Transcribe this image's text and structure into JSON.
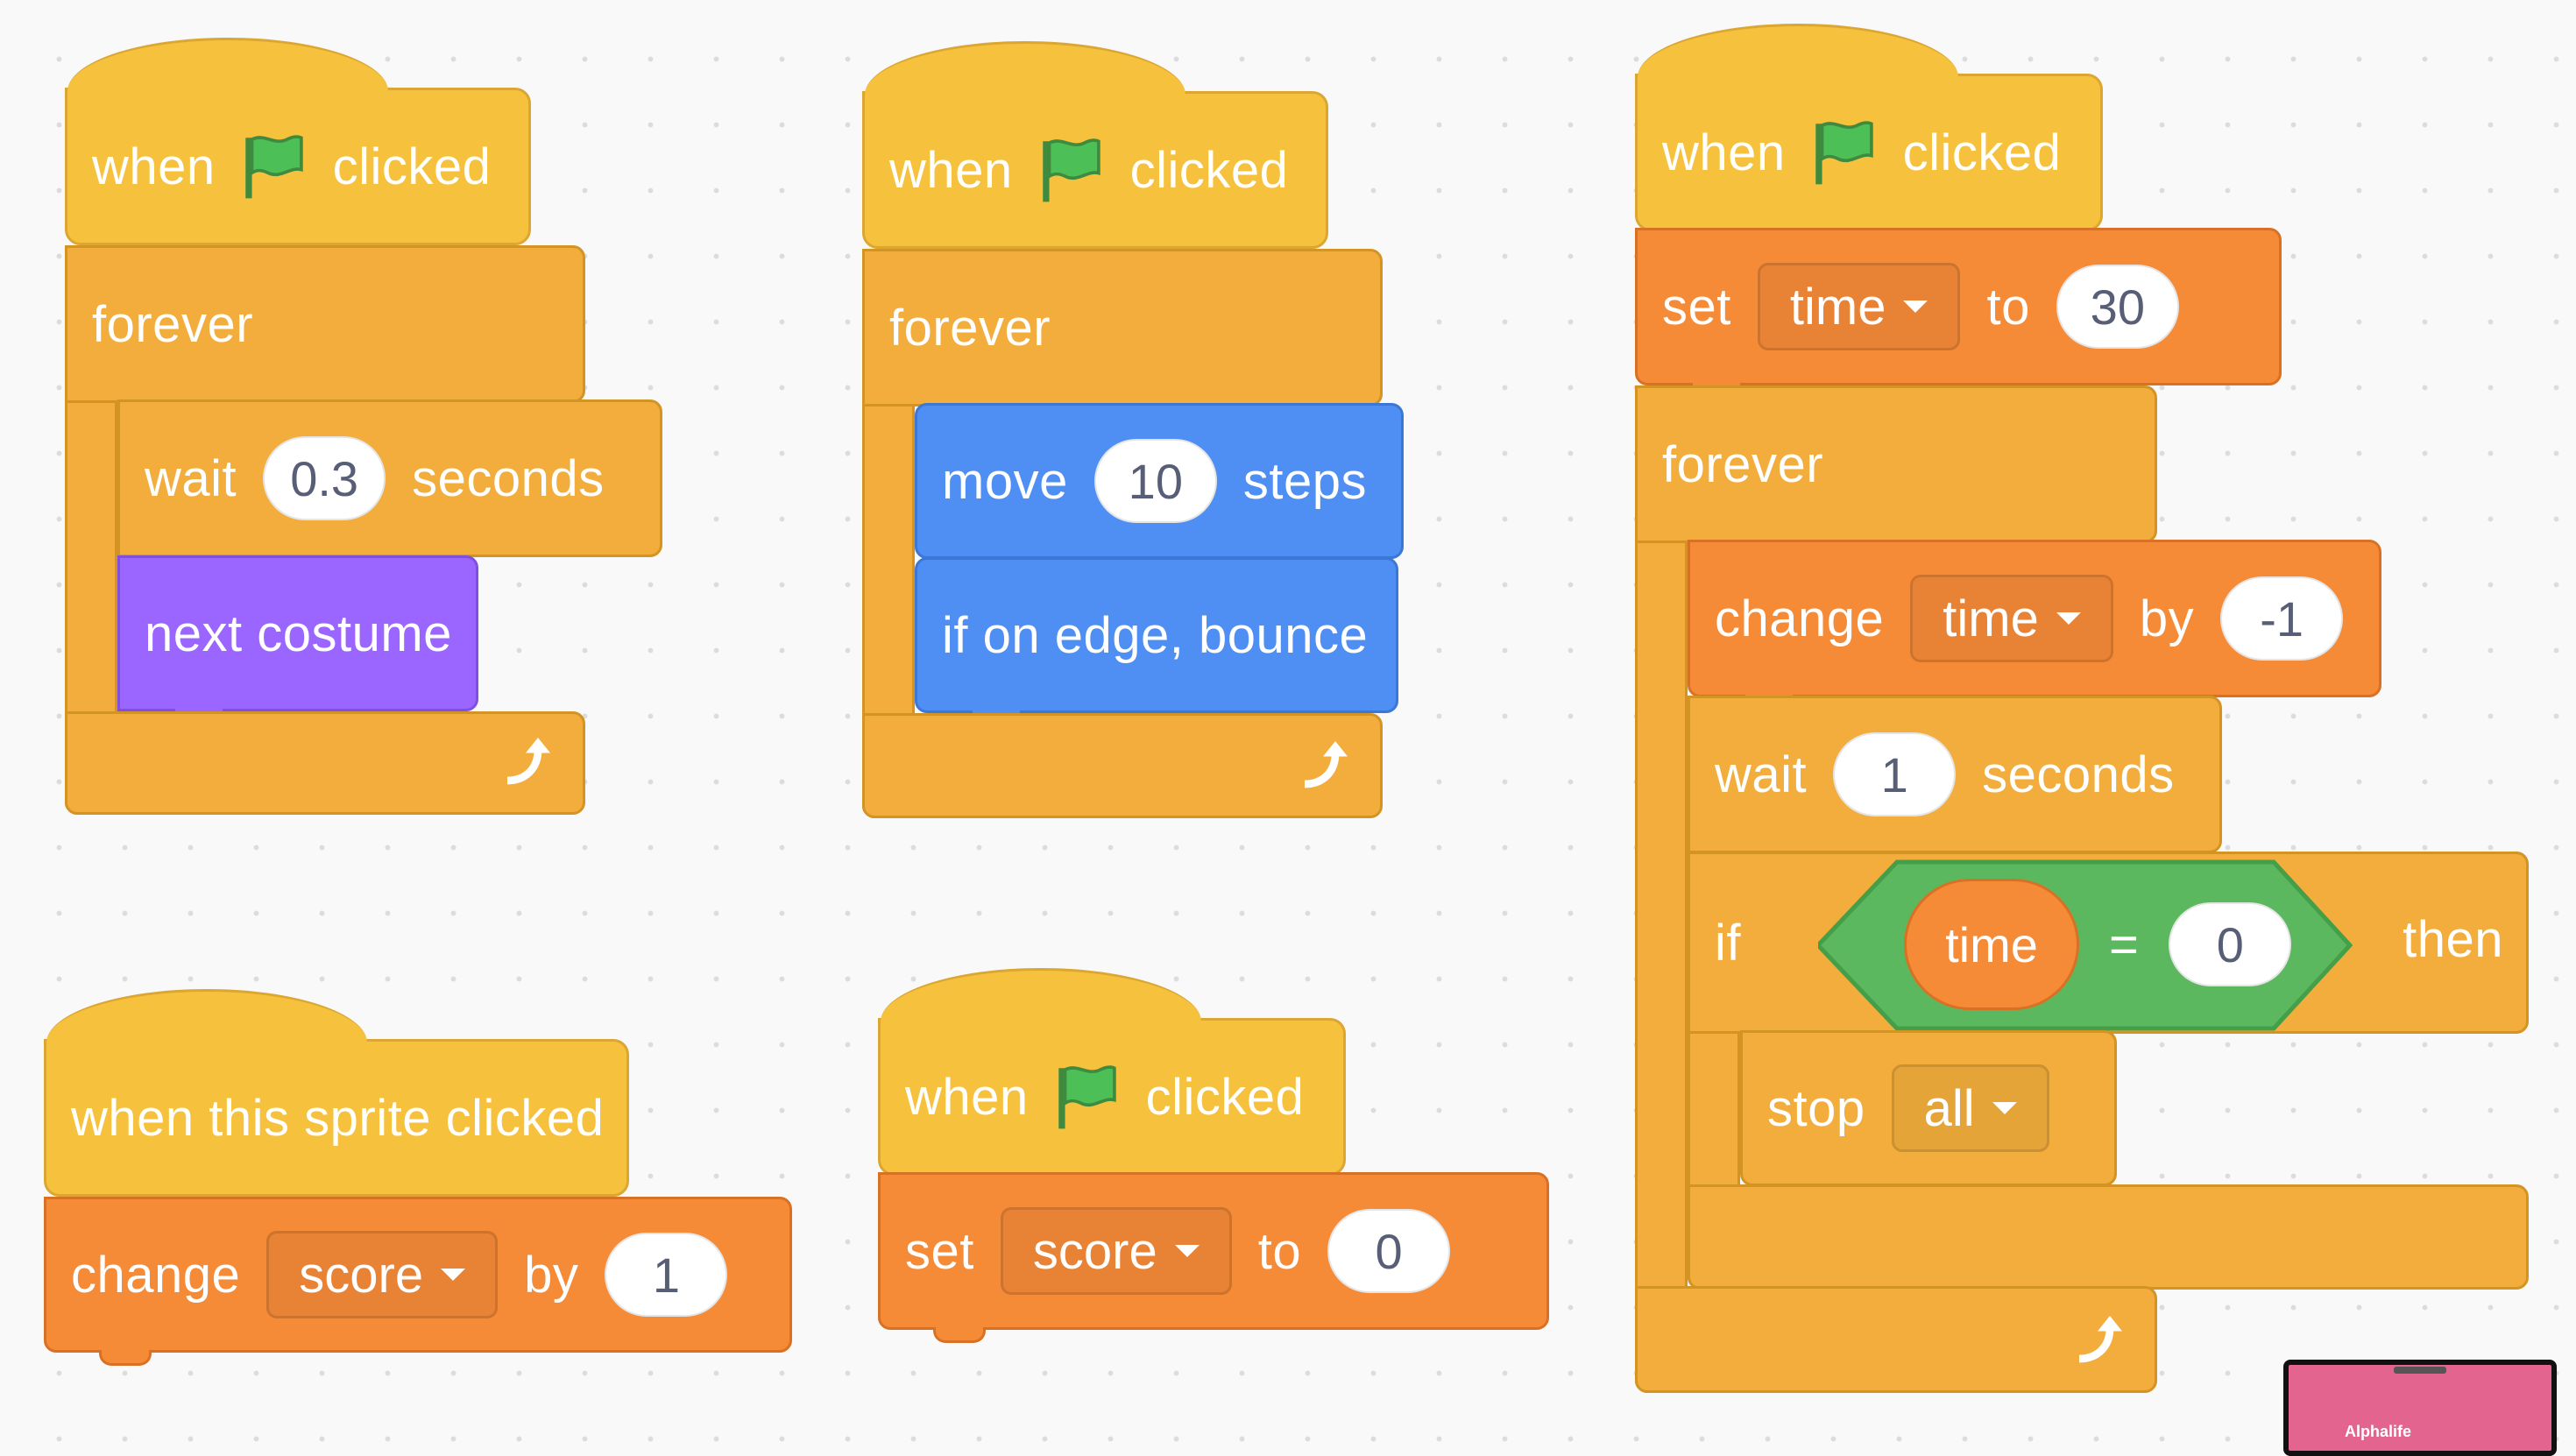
{
  "scripts": [
    {
      "hat": {
        "w1": "when",
        "icon": "green-flag-icon",
        "w2": "clicked"
      },
      "forever": "forever",
      "body": [
        {
          "type": "wait",
          "w1": "wait",
          "value": "0.3",
          "w2": "seconds"
        },
        {
          "type": "looks",
          "label": "next costume"
        }
      ]
    },
    {
      "hat": {
        "w1": "when",
        "icon": "green-flag-icon",
        "w2": "clicked"
      },
      "forever": "forever",
      "body": [
        {
          "type": "motion",
          "w1": "move",
          "value": "10",
          "w2": "steps"
        },
        {
          "type": "motion",
          "label": "if on edge, bounce"
        }
      ]
    },
    {
      "hat": {
        "w1": "when",
        "icon": "green-flag-icon",
        "w2": "clicked"
      },
      "set": {
        "w1": "set",
        "var": "time",
        "w2": "to",
        "value": "30"
      },
      "forever": "forever",
      "change": {
        "w1": "change",
        "var": "time",
        "w2": "by",
        "value": "-1"
      },
      "wait": {
        "w1": "wait",
        "value": "1",
        "w2": "seconds"
      },
      "if": {
        "w1": "if",
        "left": "time",
        "op": "=",
        "right": "0",
        "w2": "then"
      },
      "stop": {
        "w1": "stop",
        "option": "all"
      }
    },
    {
      "hat": {
        "label": "when this sprite clicked"
      },
      "change": {
        "w1": "change",
        "var": "score",
        "w2": "by",
        "value": "1"
      }
    },
    {
      "hat": {
        "w1": "when",
        "icon": "green-flag-icon",
        "w2": "clicked"
      },
      "set": {
        "w1": "set",
        "var": "score",
        "w2": "to",
        "value": "0"
      }
    }
  ],
  "thumbnail": {
    "label": "Alphalife"
  },
  "colors": {
    "events": "#f6c23d",
    "control": "#f2ad3c",
    "variables": "#f58a37",
    "motion": "#4f8ff3",
    "looks": "#9a66ff",
    "operators": "#5cb85e",
    "thumbnail": "#e2648f"
  }
}
